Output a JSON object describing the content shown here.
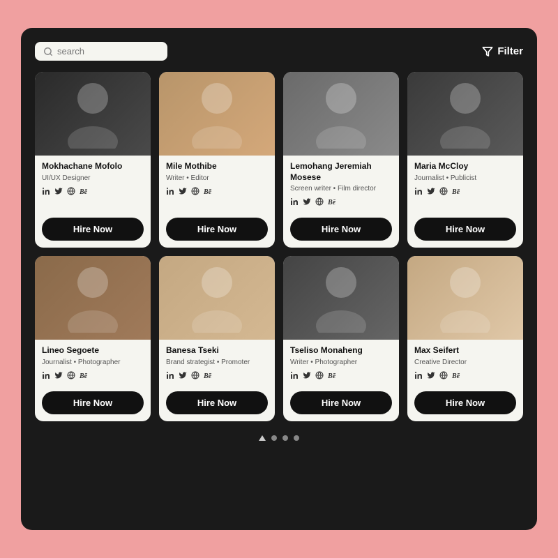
{
  "app": {
    "bg_color": "#f0a0a0",
    "container_bg": "#1a1a1a"
  },
  "search": {
    "placeholder": "search"
  },
  "filter": {
    "label": "Filter"
  },
  "profiles": [
    {
      "id": 1,
      "name": "Mokhachane Mofolo",
      "role": "UI/UX Designer",
      "photo_class": "photo-1",
      "emoji": "👤"
    },
    {
      "id": 2,
      "name": "Mile Mothibe",
      "role": "Writer • Editor",
      "photo_class": "photo-2",
      "emoji": "👤"
    },
    {
      "id": 3,
      "name": "Lemohang Jeremiah Mosese",
      "role": "Screen writer • Film director",
      "photo_class": "photo-3",
      "emoji": "👤"
    },
    {
      "id": 4,
      "name": "Maria McCloy",
      "role": "Journalist • Publicist",
      "photo_class": "photo-4",
      "emoji": "👤"
    },
    {
      "id": 5,
      "name": "Lineo Segoete",
      "role": "Journalist • Photographer",
      "photo_class": "photo-5",
      "emoji": "👤"
    },
    {
      "id": 6,
      "name": "Banesa Tseki",
      "role": "Brand strategist • Promoter",
      "photo_class": "photo-6",
      "emoji": "👤"
    },
    {
      "id": 7,
      "name": "Tseliso Monaheng",
      "role": "Writer • Photographer",
      "photo_class": "photo-7",
      "emoji": "👤"
    },
    {
      "id": 8,
      "name": "Max Seifert",
      "role": "Creative Director",
      "photo_class": "photo-8",
      "emoji": "👤"
    }
  ],
  "hire_btn_label": "Hire Now",
  "social_icons": [
    "in",
    "🐦",
    "🌐",
    "Bē"
  ],
  "pagination": {
    "pages": 4,
    "active": 0
  }
}
